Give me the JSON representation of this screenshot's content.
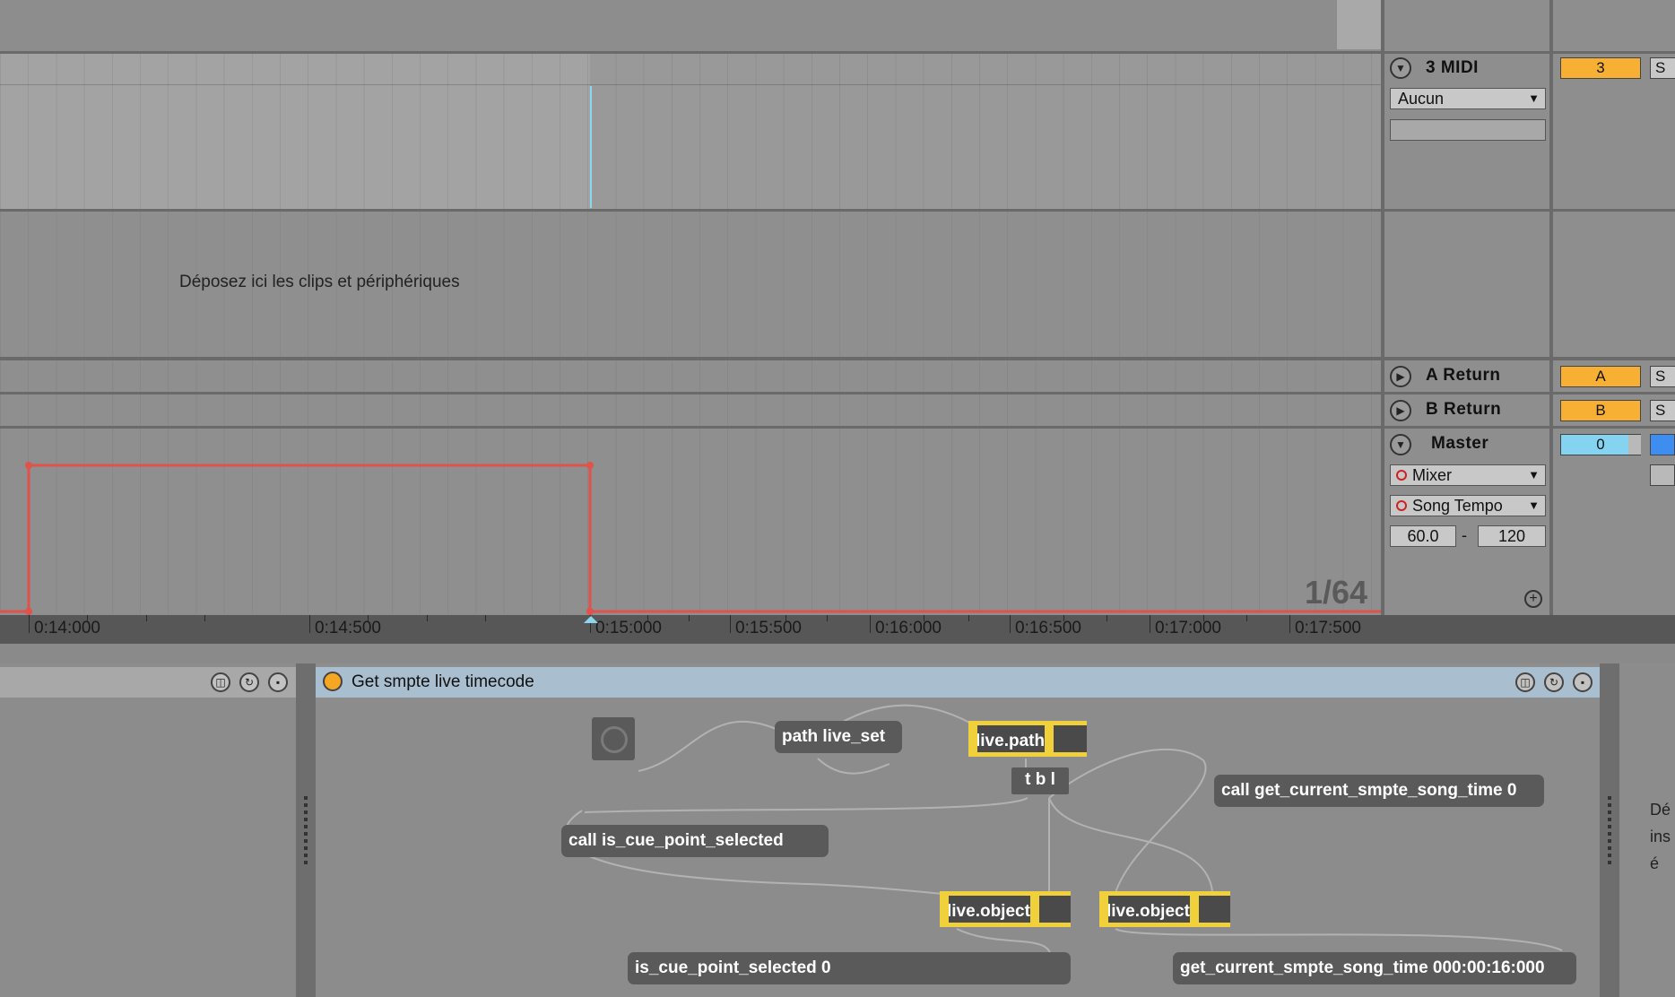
{
  "arrangement": {
    "drop_hint": "Déposez ici les clips et périphériques",
    "zoom_label": "1/64",
    "timeline_labels": [
      "0:14:000",
      "0:14:500",
      "0:15:000",
      "0:15:500",
      "0:16:000",
      "0:16:500",
      "0:17:000",
      "0:17:500"
    ]
  },
  "tracks": {
    "midi": {
      "name": "3 MIDI",
      "input": "Aucun",
      "number": "3",
      "solo": "S"
    },
    "a_return": {
      "name": "A Return",
      "letter": "A",
      "solo": "S"
    },
    "b_return": {
      "name": "B Return",
      "letter": "B",
      "solo": "S"
    },
    "master": {
      "name": "Master",
      "device_chooser": "Mixer",
      "parameter_chooser": "Song Tempo",
      "range_min": "60.0",
      "range_sep": "-",
      "range_max": "120",
      "number": "0"
    }
  },
  "colors": {
    "track_orange": "#f8b034",
    "master_blue": "#84d3f0",
    "automation_red": "#e0524a",
    "playhead_cyan": "#8ad7ee",
    "live_yellow": "#f0d13c"
  },
  "device": {
    "title": "Get smpte live timecode",
    "objects": {
      "path_message": "path live_set",
      "live_path": "live.path",
      "trigger": "t b l",
      "call_smpte": "call get_current_smpte_song_time 0",
      "call_cue": "call is_cue_point_selected",
      "live_object_1": "live.object",
      "live_object_2": "live.object",
      "cue_result": "is_cue_point_selected 0",
      "smpte_result": "get_current_smpte_song_time 000:00:16:000"
    },
    "right_clip_text": [
      "Dé",
      "ins",
      "é"
    ]
  },
  "icons": [
    "triangle-toggle-icon",
    "plus-icon",
    "power-icon",
    "hot-swap-icon",
    "swap-icon",
    "save-icon"
  ]
}
